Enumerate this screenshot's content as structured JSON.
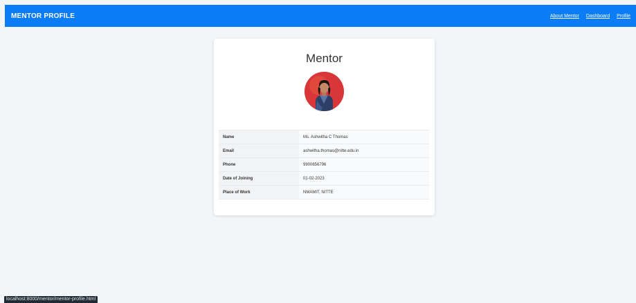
{
  "navbar": {
    "brand": "MENTOR PROFILE",
    "links": [
      "About Mentor",
      "Dashboard",
      "Profile"
    ]
  },
  "card": {
    "title": "Mentor",
    "rows": [
      {
        "label": "Name",
        "value": "Ms. Ashwitha C Thomas"
      },
      {
        "label": "Email",
        "value": "ashwitha.thomas@nitte.edu.in"
      },
      {
        "label": "Phone",
        "value": "9900656796"
      },
      {
        "label": "Date of Joining",
        "value": "01-02-2023"
      },
      {
        "label": "Place of Work",
        "value": "NMAMIT, NITTE"
      }
    ]
  },
  "status_bar": {
    "url": "localhost:8000/mentor/mentor-profile.html"
  },
  "colors": {
    "navbar_bg": "#0a7cf5",
    "page_bg": "#f3f6f9",
    "avatar_bg": "#d9363a"
  }
}
